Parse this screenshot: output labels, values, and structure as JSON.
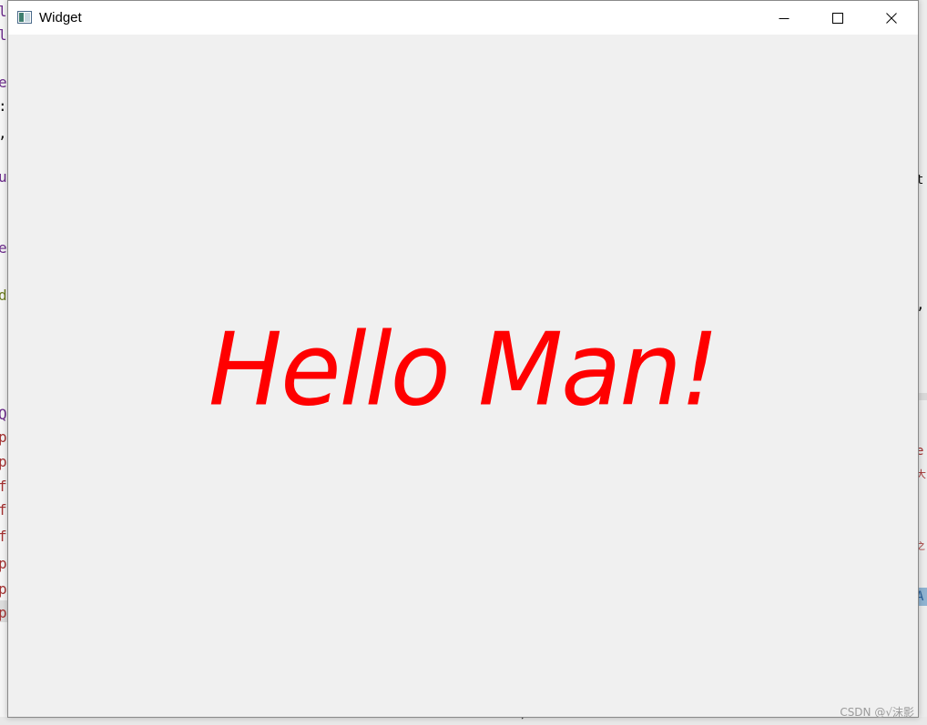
{
  "window": {
    "title": "Widget",
    "buttons": {
      "minimize_icon": "minimize-icon",
      "maximize_icon": "maximize-icon",
      "close_icon": "close-icon"
    }
  },
  "content": {
    "text": "Hello Man!",
    "text_color": "#ff0000",
    "background_color": "#f0f0f0"
  },
  "background": {
    "left_fragments": [
      "l",
      "l",
      "e",
      ":",
      ",",
      "u",
      "e",
      "d",
      "Q",
      "p",
      "p",
      "f",
      "f",
      "f",
      "p",
      "p",
      "p"
    ],
    "right_fragments": [
      "t",
      ",",
      "e",
      "大",
      "之",
      "A"
    ],
    "bottom_fragment": ")"
  },
  "watermark": "CSDN @√沫影"
}
